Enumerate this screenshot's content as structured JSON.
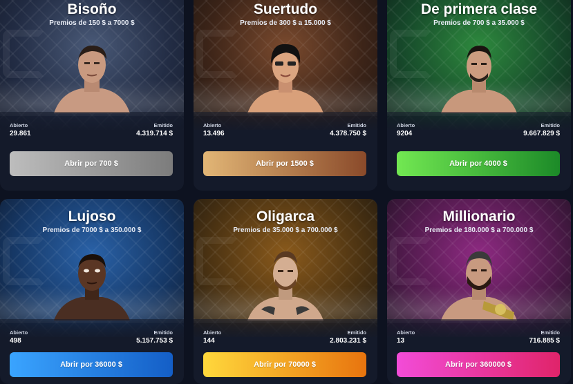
{
  "cases": [
    {
      "title": "Bisoño",
      "prize": "Premios de 150 $ a 7000 $",
      "opened_label": "Abierto",
      "opened": "29.861",
      "issued_label": "Emitido",
      "issued": "4.319.714 $",
      "button": "Abrir por 700 $",
      "theme": "#3a4a66",
      "button_from": "#b9b9b9",
      "button_to": "#7f7f7f"
    },
    {
      "title": "Suertudo",
      "prize": "Premios de 300 $ a 15.000 $",
      "opened_label": "Abierto",
      "opened": "13.496",
      "issued_label": "Emitido",
      "issued": "4.378.750 $",
      "button": "Abrir por 1500 $",
      "theme": "#6a3a22",
      "button_from": "#e0b070",
      "button_to": "#8a4b2c"
    },
    {
      "title": "De primera clase",
      "prize": "Premios de 700 $ a 35.000 $",
      "opened_label": "Abierto",
      "opened": "9204",
      "issued_label": "Emitido",
      "issued": "9.667.829 $",
      "button": "Abrir por 4000 $",
      "theme": "#1f6b2e",
      "button_from": "#6ee04e",
      "button_to": "#1d8f2a"
    },
    {
      "title": "Lujoso",
      "prize": "Premios de 7000 $ a 350.000 $",
      "opened_label": "Abierto",
      "opened": "498",
      "issued_label": "Emitido",
      "issued": "5.157.753 $",
      "button": "Abrir por 36000 $",
      "theme": "#1b4e8c",
      "button_from": "#3aa2ff",
      "button_to": "#145fc8"
    },
    {
      "title": "Oligarca",
      "prize": "Premios de 35.000 $ a 700.000 $",
      "opened_label": "Abierto",
      "opened": "144",
      "issued_label": "Emitido",
      "issued": "2.803.231 $",
      "button": "Abrir por 70000 $",
      "theme": "#7a4a12",
      "button_from": "#ffd23a",
      "button_to": "#e87a12"
    },
    {
      "title": "Millionario",
      "prize": "Premios de 180.000 $ a 700.000 $",
      "opened_label": "Abierto",
      "opened": "13",
      "issued_label": "Emitido",
      "issued": "716.885 $",
      "button": "Abrir por 360000 $",
      "theme": "#7a1e6e",
      "button_from": "#f04ad6",
      "button_to": "#e0246a"
    }
  ],
  "icons": {
    "fighter": "fighter-portrait-icon"
  }
}
